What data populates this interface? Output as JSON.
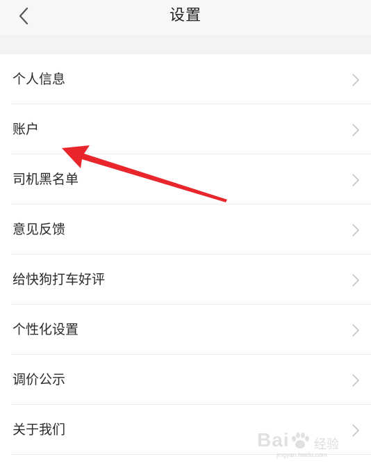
{
  "header": {
    "title": "设置",
    "back_icon": "chevron-left-icon"
  },
  "menu": {
    "items": [
      {
        "label": "个人信息"
      },
      {
        "label": "账户"
      },
      {
        "label": "司机黑名单"
      },
      {
        "label": "意见反馈"
      },
      {
        "label": "给快狗打车好评"
      },
      {
        "label": "个性化设置"
      },
      {
        "label": "调价公示"
      },
      {
        "label": "关于我们"
      }
    ],
    "row_icon": "chevron-right-icon"
  },
  "annotation": {
    "arrow_color": "#e8262c"
  },
  "watermark": {
    "brand": "Bai",
    "cn": "经验",
    "sub": "jingyan.baidu.com"
  }
}
